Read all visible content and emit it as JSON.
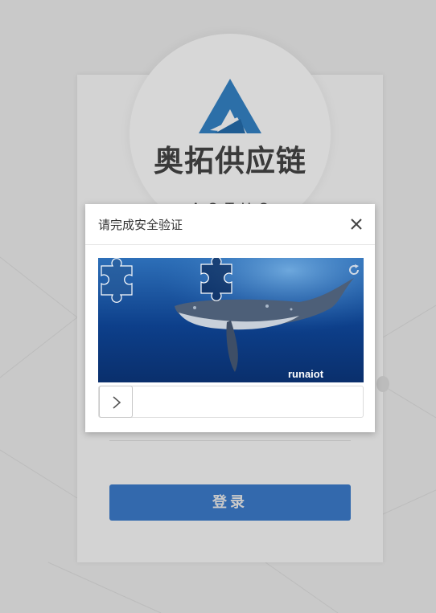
{
  "brand": {
    "name_cn": "奥拓供应链",
    "name_en": "AOTUO",
    "logo_color": "#2c6fa8"
  },
  "login": {
    "submit_label": "登录",
    "button_color": "#3369ad"
  },
  "captcha": {
    "title": "请完成安全验证",
    "close_icon": "close-icon",
    "refresh_icon": "refresh-icon",
    "watermark": "runaiot",
    "puzzle_icon": "puzzle-piece-icon",
    "slider_icon": "chevron-right-icon"
  }
}
